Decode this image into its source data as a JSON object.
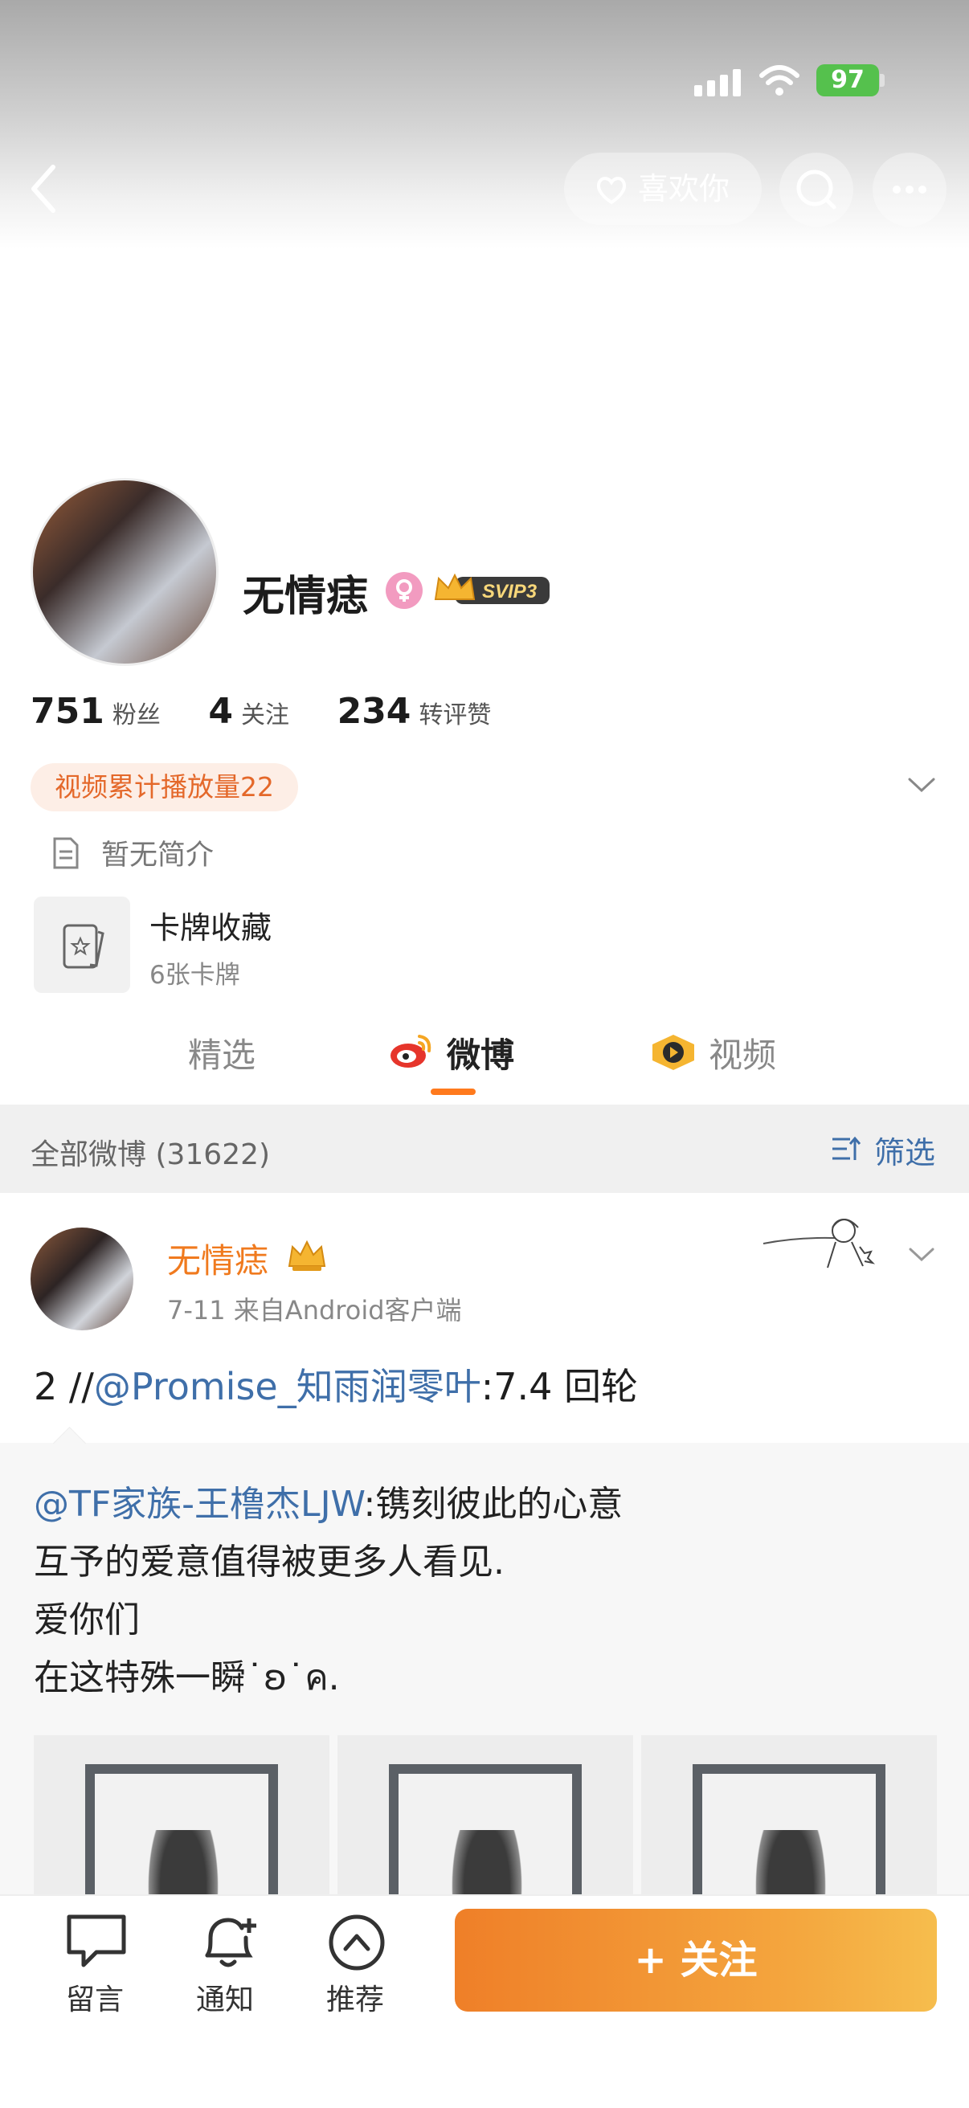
{
  "status_bar": {
    "battery": "97"
  },
  "nav": {
    "like_label": "喜欢你"
  },
  "profile": {
    "name": "无情痣",
    "vip_badge": "SVIP3",
    "stats": [
      {
        "value": "751",
        "label": "粉丝"
      },
      {
        "value": "4",
        "label": "关注"
      },
      {
        "value": "234",
        "label": "转评赞"
      }
    ],
    "video_badge": "视频累计播放量22",
    "bio": "暂无简介",
    "cards": {
      "title": "卡牌收藏",
      "subtitle": "6张卡牌"
    }
  },
  "tabs": [
    {
      "label": "精选",
      "active": false
    },
    {
      "label": "微博",
      "active": true
    },
    {
      "label": "视频",
      "active": false
    }
  ],
  "filter": {
    "count_label": "全部微博 (31622)",
    "filter_label": "筛选"
  },
  "post": {
    "author": "无情痣",
    "meta": "7-11  来自Android客户端",
    "text_prefix": "2  //",
    "mention": "@Promise_知雨润零叶",
    "text_suffix": ":7.4 回轮",
    "quote": {
      "mention": "@TF家族-王橹杰LJW",
      "line1_suffix": ":镌刻彼此的心意",
      "line2": "互予的爱意值得被更多人看见.",
      "line3": "爱你们",
      "line4": "在这特殊一瞬˙ʚ˙ค."
    }
  },
  "bottom_bar": {
    "comment": "留言",
    "notify": "通知",
    "recommend": "推荐",
    "follow": "+ 关注"
  },
  "colors": {
    "accent": "#f07a1e",
    "link": "#3f6fa9",
    "follow_start": "#ef7f28",
    "follow_end": "#f6bd4d"
  }
}
